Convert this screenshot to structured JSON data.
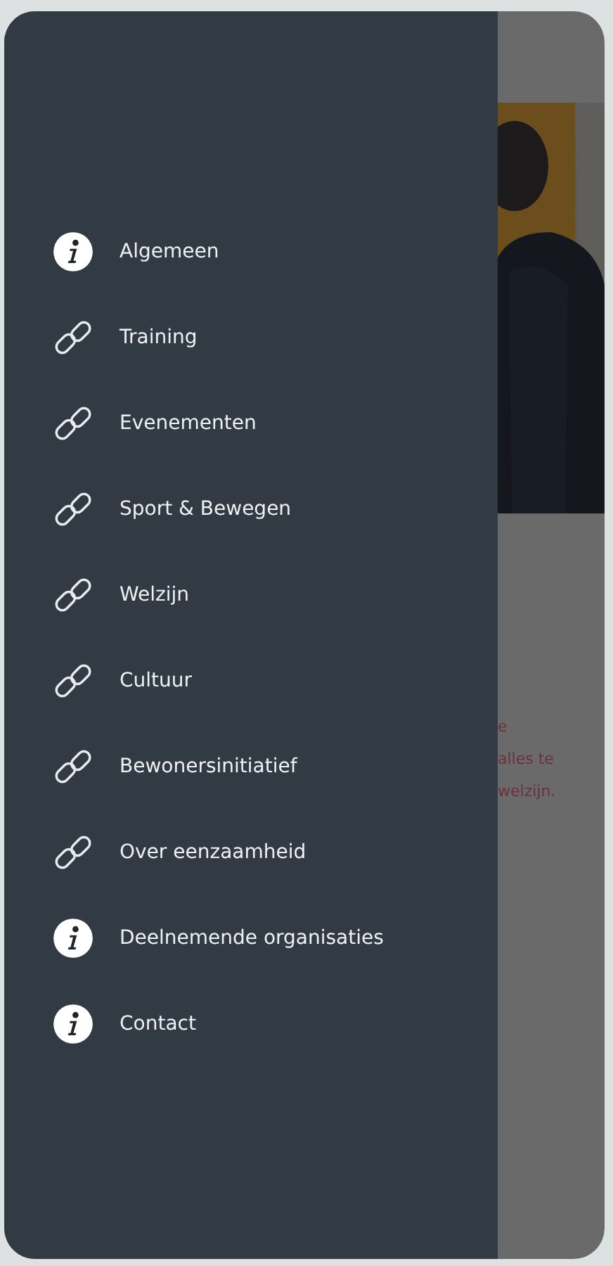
{
  "menu": {
    "items": [
      {
        "label": "Algemeen",
        "kind": "info"
      },
      {
        "label": "Training",
        "kind": "link"
      },
      {
        "label": "Evenementen",
        "kind": "link"
      },
      {
        "label": "Sport & Bewegen",
        "kind": "link"
      },
      {
        "label": "Welzijn",
        "kind": "link"
      },
      {
        "label": "Cultuur",
        "kind": "link"
      },
      {
        "label": "Bewonersinitiatief",
        "kind": "link"
      },
      {
        "label": "Over eenzaamheid",
        "kind": "link"
      },
      {
        "label": "Deelnemende organisaties",
        "kind": "info"
      },
      {
        "label": "Contact",
        "kind": "info"
      }
    ]
  },
  "page_behind": {
    "text_lines": [
      "e",
      "alles te",
      "welzijn."
    ]
  }
}
